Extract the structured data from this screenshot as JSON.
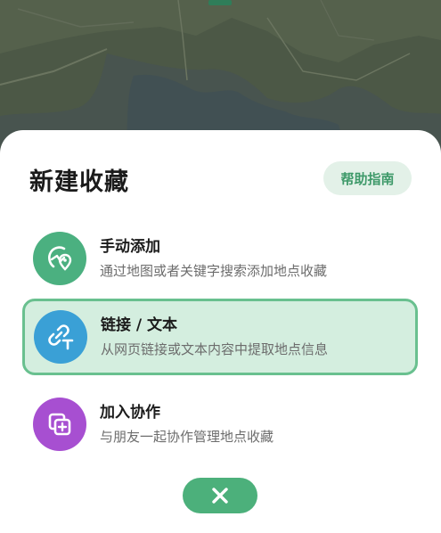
{
  "sheet": {
    "title": "新建收藏",
    "help_label": "帮助指南"
  },
  "options": [
    {
      "title": "手动添加",
      "subtitle": "通过地图或者关键字搜索添加地点收藏",
      "icon": "map-pin-icon",
      "color": "#4bb080"
    },
    {
      "title": "链接 / 文本",
      "subtitle": "从网页链接或文本内容中提取地点信息",
      "icon": "link-text-icon",
      "color": "#3aa0d6",
      "selected": true
    },
    {
      "title": "加入协作",
      "subtitle": "与朋友一起协作管理地点收藏",
      "icon": "collaborate-icon",
      "color": "#a74fd1"
    }
  ],
  "close": {
    "icon": "close-icon",
    "color": "#4cb07b"
  }
}
